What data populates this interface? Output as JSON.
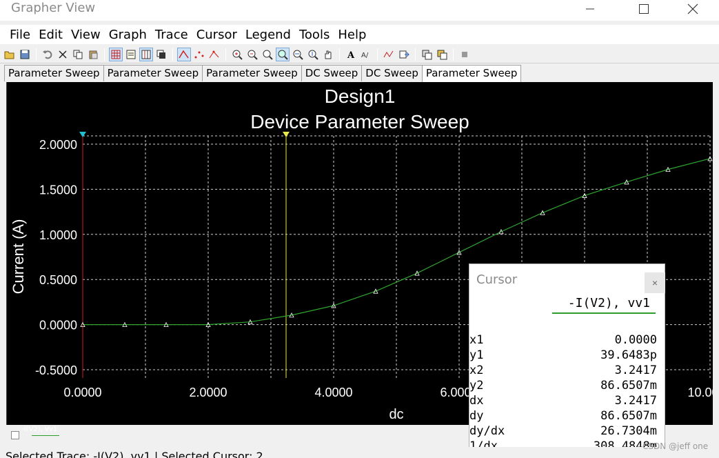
{
  "window": {
    "title": "Grapher View"
  },
  "menu": [
    "File",
    "Edit",
    "View",
    "Graph",
    "Trace",
    "Cursor",
    "Legend",
    "Tools",
    "Help"
  ],
  "toolbar": {
    "icons": [
      "open-icon",
      "save-icon",
      "undo-icon",
      "cut-icon",
      "copy-icon",
      "paste-icon",
      "grid-icon",
      "legend-icon",
      "cursor-toggle-icon",
      "overlay-icon",
      "line-plot-icon",
      "scatter-icon",
      "line-marker-icon",
      "zoom-in-icon",
      "zoom-out-icon",
      "zoom-fit-icon",
      "zoom-area-icon",
      "zoom-x-icon",
      "zoom-y-icon",
      "pan-icon",
      "text-icon",
      "font-icon",
      "trace-icon",
      "export-icon",
      "copy-graph-icon",
      "stop-icon"
    ]
  },
  "tabs": [
    {
      "label": "Parameter Sweep",
      "active": false
    },
    {
      "label": "Parameter Sweep",
      "active": false
    },
    {
      "label": "Parameter Sweep",
      "active": false
    },
    {
      "label": "DC Sweep",
      "active": false
    },
    {
      "label": "DC Sweep",
      "active": false
    },
    {
      "label": "Parameter Sweep",
      "active": true
    }
  ],
  "chart_data": {
    "type": "line",
    "title": "Design1",
    "subtitle": "Device Parameter Sweep",
    "xlabel": "dc",
    "ylabel": "Current (A)",
    "xlim": [
      0,
      10
    ],
    "ylim": [
      -0.5,
      2.0
    ],
    "xticks": [
      "0.0000",
      "2.0000",
      "4.0000",
      "6.0000",
      "8.0000",
      "10.0000"
    ],
    "yticks": [
      "2.0000",
      "1.5000",
      "1.0000",
      "0.5000",
      "0.0000",
      "-0.5000"
    ],
    "grid": true,
    "background": "#000000",
    "series": [
      {
        "name": "-I(V2), vv1",
        "color": "#2ea62e",
        "x": [
          0,
          0.67,
          1.33,
          2.0,
          2.67,
          3.33,
          4.0,
          4.67,
          5.33,
          6.0,
          6.67,
          7.33,
          8.0,
          8.67,
          9.33,
          10.0
        ],
        "y": [
          0.0,
          0.0,
          0.0,
          0.0,
          0.03,
          0.105,
          0.21,
          0.37,
          0.57,
          0.8,
          1.03,
          1.24,
          1.43,
          1.58,
          1.72,
          1.84
        ]
      }
    ],
    "cursors": [
      {
        "label": "1",
        "x": 0.0,
        "color": "#d02020"
      },
      {
        "label": "2",
        "x": 3.2417,
        "color": "#e8e84a"
      }
    ]
  },
  "cursor_panel": {
    "title": "Cursor",
    "header": "-I(V2), vv1",
    "rows": [
      {
        "label": "x1",
        "value": "0.0000"
      },
      {
        "label": "y1",
        "value": "39.6483p"
      },
      {
        "label": "x2",
        "value": "3.2417"
      },
      {
        "label": "y2",
        "value": "86.6507m"
      },
      {
        "label": "dx",
        "value": "3.2417"
      },
      {
        "label": "dy",
        "value": "86.6507m"
      },
      {
        "label": "dy/dx",
        "value": "26.7304m"
      },
      {
        "label": "1/dx",
        "value": "308.4848m"
      }
    ]
  },
  "legend": {
    "entry": "-I(V2), vv1"
  },
  "status": {
    "text": "Selected Trace: -I(V2), vv1   |   Selected Cursor: 2"
  },
  "watermark": "CSDN @jeff one"
}
